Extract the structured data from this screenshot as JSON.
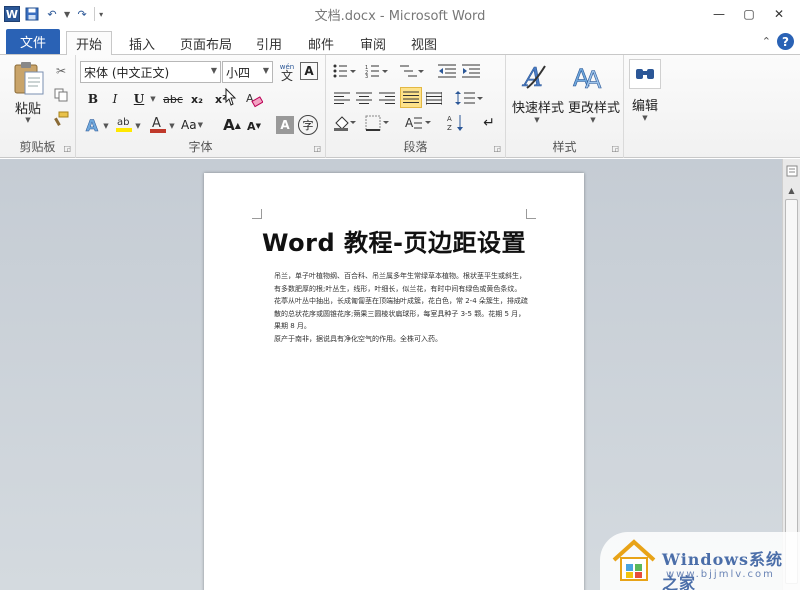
{
  "window": {
    "title": "文档.docx - Microsoft Word",
    "controls": [
      "—",
      "▢",
      "✕"
    ]
  },
  "qat": {
    "undo_icon": "undo-icon",
    "redo_icon": "redo-icon"
  },
  "tabs": {
    "file": "文件",
    "items": [
      "开始",
      "插入",
      "页面布局",
      "引用",
      "邮件",
      "审阅",
      "视图"
    ],
    "active": "开始"
  },
  "ribbon": {
    "clipboard": {
      "label": "剪贴板",
      "paste": "粘贴"
    },
    "font": {
      "label": "字体",
      "font_name": "宋体 (中文正文)",
      "font_size": "小四",
      "bold": "B",
      "italic": "I",
      "underline": "U",
      "strike": "abc",
      "sub": "x₂",
      "sup": "x²",
      "grow": "A",
      "shrink": "A",
      "case": "Aa",
      "char_shading": "A",
      "enclose": "字",
      "phonetic": "wén",
      "clear": "A"
    },
    "paragraph": {
      "label": "段落"
    },
    "styles": {
      "label": "样式",
      "quick": "快速样式",
      "change": "更改样式"
    },
    "editing": {
      "label": "编辑"
    }
  },
  "document": {
    "title": "Word 教程-页边距设置",
    "paragraphs": [
      "吊兰，单子叶植物纲、百合科、吊兰属多年生常绿草本植物。根状茎平生或斜生，有多数肥厚的根;叶丛生，线形，叶细长，似兰花，有时中间有绿色或黄色条纹。",
      "花葶从叶丛中抽出，长成匍匐茎在顶端抽叶成簇，花白色，常 2-4 朵簇生，排成疏散的总状花序或圆锥花序;蒴果三圆棱状扁球形，每室具种子 3-5 颗。花期 5 月，果期 8 月。",
      "原产于南非，据说具有净化空气的作用。全株可入药。"
    ]
  },
  "watermark": {
    "line1": "Windows系统之家",
    "line2": "www.bjjmlv.com"
  }
}
